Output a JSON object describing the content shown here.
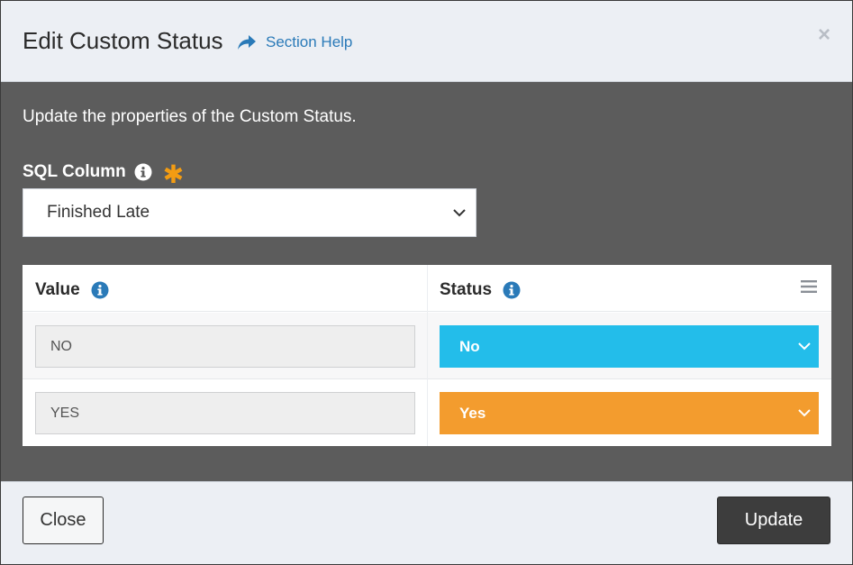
{
  "header": {
    "title": "Edit Custom Status",
    "help_label": "Section Help",
    "close_glyph": "×"
  },
  "body": {
    "intro": "Update the properties of the Custom Status.",
    "sql_column": {
      "label": "SQL Column",
      "required_marker": "✱",
      "selected": "Finished Late"
    }
  },
  "grid": {
    "columns": [
      "Value",
      "Status"
    ],
    "rows": [
      {
        "value": "NO",
        "status": "No",
        "status_color": "#23bdea"
      },
      {
        "value": "YES",
        "status": "Yes",
        "status_color": "#f39c2e"
      }
    ]
  },
  "footer": {
    "close_label": "Close",
    "update_label": "Update"
  },
  "colors": {
    "accent_link": "#2a7ab8",
    "required": "#f39c12",
    "info_icon": "#2a7ab8"
  },
  "icons": {
    "help": "share-arrow-icon",
    "info": "info-circle-icon",
    "menu": "hamburger-menu-icon",
    "dropdown": "chevron-down-icon"
  }
}
